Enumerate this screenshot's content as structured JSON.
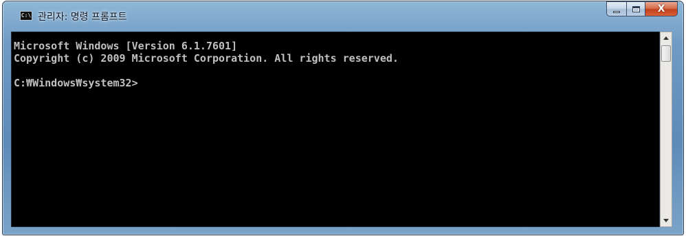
{
  "window": {
    "title": "관리자: 명령 프롬프트",
    "icon_label": "C:\\",
    "icon_name": "console-app-icon"
  },
  "controls": {
    "minimize": "minimize-icon",
    "maximize": "maximize-icon",
    "close": "close-icon",
    "close_glyph": "X"
  },
  "console": {
    "lines": [
      "Microsoft Windows [Version 6.1.7601]",
      "Copyright (c) 2009 Microsoft Corporation. All rights reserved.",
      "",
      "C:₩Windows₩system32>"
    ],
    "text_color": "#c0c0c0",
    "background_color": "#000000"
  },
  "scrollbar": {
    "up_icon": "scroll-up-arrow-icon",
    "down_icon": "scroll-down-arrow-icon"
  }
}
